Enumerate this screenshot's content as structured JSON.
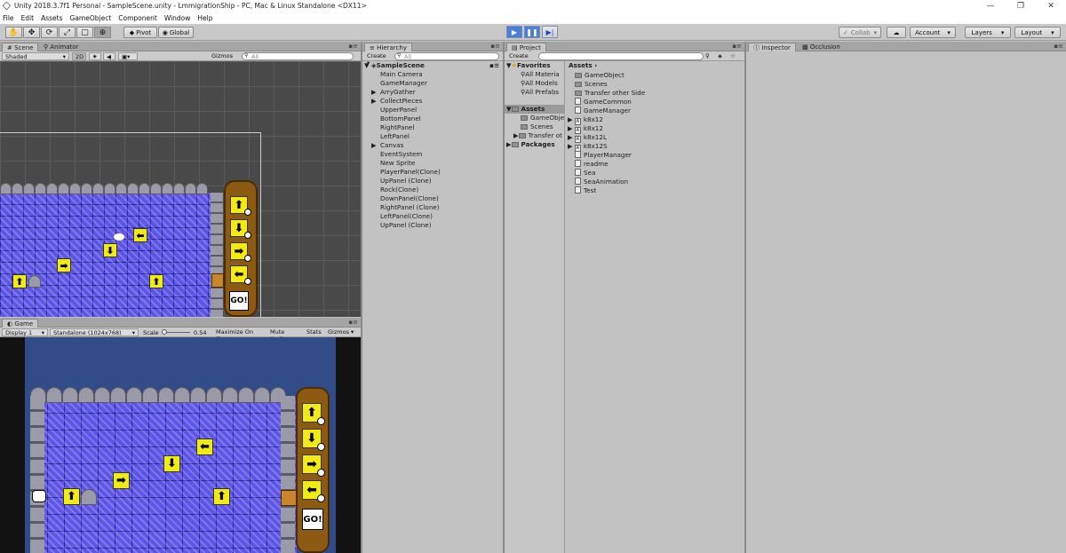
{
  "window": {
    "title": "Unity 2018.3.7f1 Personal - SampleScene.unity - LmmigrationShip - PC, Mac & Linux Standalone <DX11>",
    "minimize": "—",
    "restore": "❐",
    "close": "✕"
  },
  "menu": [
    "File",
    "Edit",
    "Assets",
    "GameObject",
    "Component",
    "Window",
    "Help"
  ],
  "toolbar": {
    "pivot": "Pivot",
    "global": "Global",
    "collab": "Collab",
    "account": "Account",
    "layers": "Layers",
    "layout": "Layout"
  },
  "scene_panel": {
    "tab_scene": "Scene",
    "tab_animator": "Animator",
    "shading": "Shaded",
    "mode_2d": "2D",
    "gizmos": "Gizmos",
    "search_placeholder": "All"
  },
  "game_panel": {
    "tab": "Game",
    "display": "Display 1",
    "resolution": "Standalone (1024x768)",
    "scale_label": "Scale",
    "scale_value": "0.54",
    "maximize": "Maximize On Play",
    "mute": "Mute Audio",
    "stats": "Stats",
    "gizmos": "Gizmos",
    "go_label": "GO!"
  },
  "hierarchy": {
    "tab": "Hierarchy",
    "create": "Create",
    "search_placeholder": "All",
    "scene": "SampleScene",
    "items": [
      "Main Camera",
      "GameManager",
      "ArryGather",
      "CollectPieces",
      "UpperPanel",
      "BottomPanel",
      "RightPanel",
      "LeftPanel",
      "Canvas",
      "EventSystem",
      "New Sprite",
      "PlayerPanel(Clone)",
      "UpPanel (Clone)",
      "Rock(Clone)",
      "DownPanel(Clone)",
      "RightPanel (Clone)",
      "LeftPanel(Clone)",
      "UpPanel (Clone)"
    ]
  },
  "project": {
    "tab": "Project",
    "create": "Create",
    "favorites": "Favorites",
    "fav_items": [
      "All Materia",
      "All Models",
      "All Prefabs"
    ],
    "assets": "Assets",
    "asset_tree": [
      "GameObje",
      "Scenes",
      "Transfer ot"
    ],
    "packages": "Packages",
    "breadcrumb": "Assets",
    "files": [
      "GameObject",
      "Scenes",
      "Transfer other Side",
      "GameCommon",
      "GameManager",
      "k8x12",
      "k8x12",
      "k8x12L",
      "k8x12S",
      "PlayerManager",
      "readme",
      "Sea",
      "SeaAnimation",
      "Test"
    ]
  },
  "inspector": {
    "tab": "Inspector",
    "tab_occlusion": "Occlusion"
  },
  "colors": {
    "accent": "#4b7fd6",
    "board": "#5d55e6",
    "tile": "#f2ea13",
    "ship": "#8c5a10"
  }
}
